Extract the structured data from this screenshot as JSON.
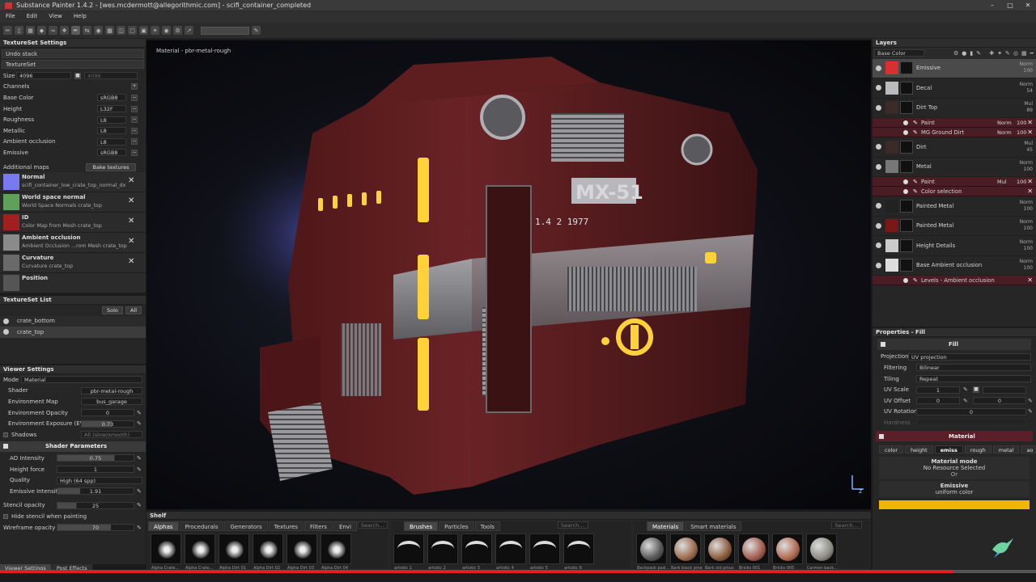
{
  "window": {
    "title": "Substance Painter 1.4.2 - [wes.mcdermott@allegorithmic.com] - scifi_container_completed"
  },
  "menu": [
    "File",
    "Edit",
    "View",
    "Help"
  ],
  "textureset_settings": {
    "header": "TextureSet Settings",
    "undo_stack": "Undo stack",
    "textureset": "TextureSet",
    "size_label": "Size",
    "size_value": "4096",
    "size_value2": "4096",
    "channels_label": "Channels",
    "channels": [
      {
        "name": "Base Color",
        "format": "sRGB8"
      },
      {
        "name": "Height",
        "format": "L32F"
      },
      {
        "name": "Roughness",
        "format": "L8"
      },
      {
        "name": "Metallic",
        "format": "L8"
      },
      {
        "name": "Ambient occlusion",
        "format": "L8"
      },
      {
        "name": "Emissive",
        "format": "sRGB8"
      }
    ],
    "additional_maps": "Additional maps",
    "bake_textures": "Bake textures",
    "maps": [
      {
        "name": "Normal",
        "file": "scifi_container_low_crate_top_normal_dx",
        "color": "#7a7af0"
      },
      {
        "name": "World space normal",
        "file": "World Space Normals crate_top",
        "color": "#5fa05a"
      },
      {
        "name": "ID",
        "file": "Color Map from Mesh crate_top",
        "color": "#a02020"
      },
      {
        "name": "Ambient occlusion",
        "file": "Ambient Occlusion ...rom Mesh crate_top",
        "color": "#8a8a8a"
      },
      {
        "name": "Curvature",
        "file": "Curvature crate_top",
        "color": "#6a6a6a"
      },
      {
        "name": "Position",
        "file": "",
        "color": "#555555"
      }
    ]
  },
  "textureset_list": {
    "header": "TextureSet List",
    "solo": "Solo",
    "all": "All",
    "items": [
      "crate_bottom",
      "crate_top"
    ]
  },
  "viewer_settings": {
    "header": "Viewer Settings",
    "mode_label": "Mode",
    "mode_value": "Material",
    "shader_label": "Shader",
    "shader_value": "pbr-metal-rough",
    "env_map_label": "Environment Map",
    "env_map_value": "bus_garage",
    "env_opacity_label": "Environment Opacity",
    "env_opacity_value": "0",
    "env_exposure_label": "Environment Exposure (EV)",
    "env_exposure_value": "0.73",
    "shadows_label": "Shadows",
    "shadows_value": "All (slow/smooth)",
    "shader_params": "Shader Parameters",
    "ao_label": "AO Intensity",
    "ao_value": "0.75",
    "height_label": "Height force",
    "height_value": "1",
    "quality_label": "Quality",
    "quality_value": "High (64 spp)",
    "emissive_label": "Emissive Intensity",
    "emissive_value": "1.91",
    "stencil_label": "Stencil opacity",
    "stencil_value": "25",
    "hide_stencil": "Hide stencil when painting",
    "wireframe_label": "Wireframe opacity",
    "wireframe_value": "70"
  },
  "bottom_tabs": [
    "Viewer Settings",
    "Post Effects"
  ],
  "viewport": {
    "label": "Material - pbr-metal-rough",
    "decal_text": "MX-51",
    "serial_text": "1.4 2 1977",
    "colors": {
      "body": "#5a1c1e",
      "metal": "#8c8c90",
      "glow": "#ffd23a",
      "dark": "#2a2a2c"
    }
  },
  "layers": {
    "header": "Layers",
    "channel_select": "Base Color",
    "items": [
      {
        "name": "Emissive",
        "blend": "Norm",
        "opacity": "100",
        "thumb": "#d83030",
        "selected": true
      },
      {
        "name": "Decal",
        "blend": "Norm",
        "opacity": "54",
        "thumb": "#bbbbbb"
      },
      {
        "name": "Dirt Top",
        "blend": "Mul",
        "opacity": "89",
        "thumb": "#3a2a28"
      },
      {
        "sub": true,
        "name": "Paint",
        "blend": "Norm",
        "opacity": "100"
      },
      {
        "sub": true,
        "name": "MG Ground Dirt",
        "blend": "Norm",
        "opacity": "100"
      },
      {
        "name": "Dirt",
        "blend": "Mul",
        "opacity": "45",
        "thumb": "#3a2a28"
      },
      {
        "name": "Metal",
        "blend": "Norm",
        "opacity": "100",
        "thumb": "#777777"
      },
      {
        "sub": true,
        "name": "Paint",
        "blend": "Mul",
        "opacity": "100"
      },
      {
        "sub": true,
        "name": "Color selection",
        "blend": "",
        "opacity": ""
      },
      {
        "name": "Painted Metal",
        "blend": "Norm",
        "opacity": "100",
        "thumb": "#222222"
      },
      {
        "name": "Painted Metal",
        "blend": "Norm",
        "opacity": "100",
        "thumb": "#7a1818"
      },
      {
        "name": "Height Details",
        "blend": "Norm",
        "opacity": "100",
        "thumb": "#cccccc"
      },
      {
        "name": "Base Ambient occlusion",
        "blend": "Norm",
        "opacity": "100",
        "thumb": "#dddddd"
      },
      {
        "sub": true,
        "name": "Levels - Ambient occlusion",
        "blend": "",
        "opacity": ""
      }
    ]
  },
  "properties": {
    "header": "Properties - Fill",
    "fill": "Fill",
    "projection_label": "Projection",
    "projection_value": "UV projection",
    "filtering_label": "Filtering",
    "filtering_value": "Bilinear",
    "tiling_label": "Tiling",
    "tiling_value": "Repeat",
    "uv_scale_label": "UV Scale",
    "uv_scale_value": "1",
    "uv_offset_label": "UV Offset",
    "uv_offset_value": "0",
    "uv_offset_value2": "0",
    "uv_rotation_label": "UV Rotation",
    "uv_rotation_value": "0",
    "hardness_label": "Hardness",
    "material": "Material",
    "channel_tabs": [
      "color",
      "height",
      "emiss",
      "rough",
      "metal",
      "ao"
    ],
    "material_mode": "Material mode",
    "no_resource": "No Resource Selected",
    "or": "Or",
    "emissive": "Emissive",
    "uniform_color": "uniform color",
    "emissive_color": "#f2b600"
  },
  "shelf": {
    "header": "Shelf",
    "tabs1": [
      "Alphas",
      "Procedurals",
      "Generators",
      "Textures",
      "Filters",
      "Envi"
    ],
    "search": "Search...",
    "alphas": [
      "Alpha Crate...",
      "Alpha Crate...",
      "Alpha Dirt 01",
      "Alpha Dirt 02",
      "Alpha Dirt 03",
      "Alpha Dirt 04"
    ],
    "tabs2": [
      "Brushes",
      "Particles",
      "Tools"
    ],
    "brushes": [
      "artistic 1",
      "artistic 2",
      "artistic 3",
      "artistic 4",
      "artistic 5",
      "artistic 6"
    ],
    "tabs3": [
      "Materials",
      "Smart materials"
    ],
    "materials": [
      "Backpack pad...",
      "Bark black pine",
      "Bark old pinus",
      "Bricks 001",
      "Bricks 005",
      "Carmen back..."
    ]
  },
  "playback_progress": 0.92
}
